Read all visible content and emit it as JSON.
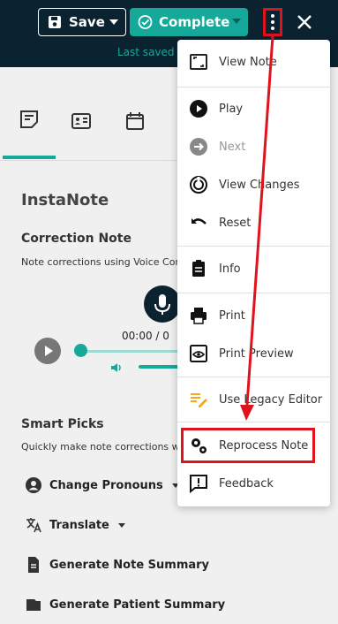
{
  "header": {
    "save_label": "Save",
    "complete_label": "Complete",
    "last_saved": "Last saved"
  },
  "note": {
    "title": "InstaNote",
    "correction_heading": "Correction Note",
    "correction_desc": "Note corrections using Voice Com",
    "time_text": "00:00 / 0"
  },
  "smart_picks": {
    "heading": "Smart Picks",
    "desc": "Quickly make note corrections wi",
    "actions": [
      {
        "label": "Change Pronouns",
        "icon": "account-circle-icon",
        "has_dropdown": true
      },
      {
        "label": "Translate",
        "icon": "translate-icon",
        "has_dropdown": true
      },
      {
        "label": "Generate Note Summary",
        "icon": "document-icon",
        "has_dropdown": false
      },
      {
        "label": "Generate Patient Summary",
        "icon": "folder-icon",
        "has_dropdown": false
      }
    ]
  },
  "menu": {
    "items": [
      {
        "label": "View Note",
        "icon": "fullscreen-icon",
        "disabled": false
      },
      {
        "label": "Play",
        "icon": "play-circle-icon",
        "disabled": false
      },
      {
        "label": "Next",
        "icon": "next-circle-icon",
        "disabled": true
      },
      {
        "label": "View Changes",
        "icon": "changes-icon",
        "disabled": false
      },
      {
        "label": "Reset",
        "icon": "undo-icon",
        "disabled": false
      },
      {
        "label": "Info",
        "icon": "clipboard-icon",
        "disabled": false
      },
      {
        "label": "Print",
        "icon": "print-icon",
        "disabled": false
      },
      {
        "label": "Print Preview",
        "icon": "preview-icon",
        "disabled": false
      },
      {
        "label": "Use Legacy Editor",
        "icon": "edit-lines-icon",
        "disabled": false
      },
      {
        "label": "Reprocess Note",
        "icon": "gears-icon",
        "disabled": false
      },
      {
        "label": "Feedback",
        "icon": "feedback-icon",
        "disabled": false
      }
    ]
  },
  "colors": {
    "header_bg": "#0b2230",
    "accent": "#16a99a",
    "annotation_red": "#e0131c"
  }
}
